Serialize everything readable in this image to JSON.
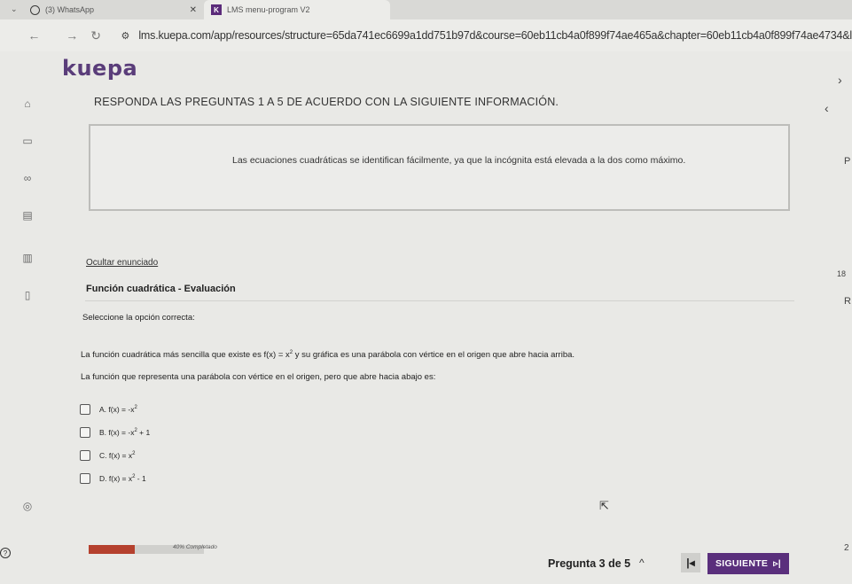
{
  "browser": {
    "tabs": [
      {
        "label": "(3) WhatsApp",
        "icon": "whatsapp-icon"
      },
      {
        "label": "LMS menu-program V2",
        "icon": "kuepa-icon"
      }
    ],
    "url": "lms.kuepa.com/app/resources/structure=65da741ec6699a1dd751b97d&course=60eb11cb4a0f899f74ae465a&chapter=60eb11cb4a0f899f74ae4734&lesson=6"
  },
  "app": {
    "logo": "kuepa",
    "instructions": "RESPONDA LAS PREGUNTAS 1 A 5 DE ACUERDO CON LA SIGUIENTE INFORMACIÓN.",
    "info_text": "Las ecuaciones cuadráticas se identifican fácilmente, ya que la incógnita está elevada a la dos como máximo.",
    "hide_statement": "Ocultar enunciado",
    "section_title": "Función cuadrática - Evaluación",
    "prompt": "Seleccione la opción correcta:",
    "question_line1_a": "La función cuadrática más sencilla que existe es",
    "question_line1_fx": "f(x) = x",
    "question_line1_sup": "2",
    "question_line1_b": "y su gráfica es una parábola con vértice en el origen que abre hacia arriba.",
    "question_line2": "La función que representa una parábola con vértice en el origen, pero que abre hacia abajo es:",
    "options": [
      {
        "label": "A.",
        "base": "f(x) = -x",
        "sup": "2",
        "tail": ""
      },
      {
        "label": "B.",
        "base": "f(x) = -x",
        "sup": "2",
        "tail": " + 1"
      },
      {
        "label": "C.",
        "base": "f(x) = x",
        "sup": "2",
        "tail": ""
      },
      {
        "label": "D.",
        "base": "f(x) = x",
        "sup": "2",
        "tail": " - 1"
      }
    ],
    "right_frags": [
      "P",
      "18",
      "R",
      "2"
    ],
    "progress_percent": 40,
    "progress_label": "40% Completado",
    "question_counter": "Pregunta 3 de 5",
    "next_label": "SIGUIENTE",
    "accent_color": "#5a2f7c",
    "progress_color": "#b5412e"
  }
}
